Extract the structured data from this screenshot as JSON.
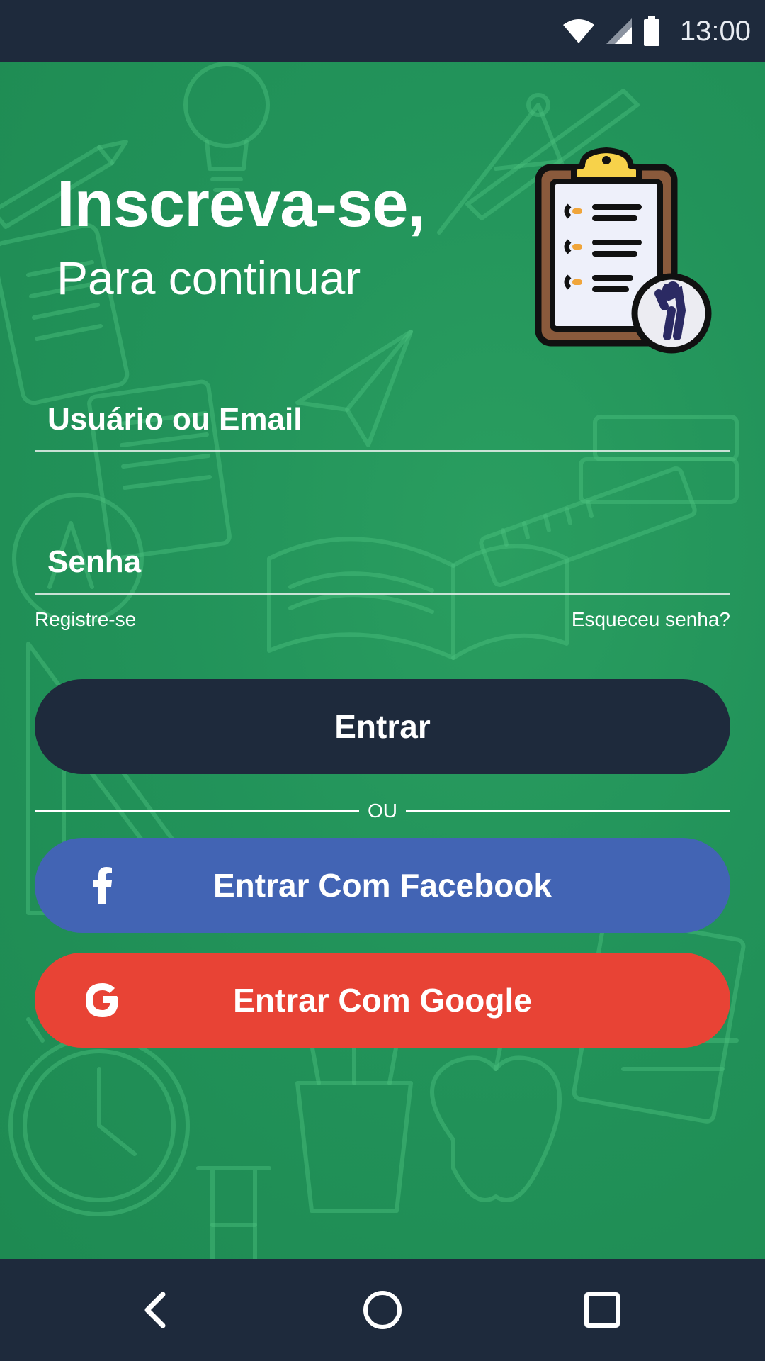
{
  "status_bar": {
    "time": "13:00",
    "icons": [
      "wifi-icon",
      "signal-icon",
      "battery-icon"
    ]
  },
  "header": {
    "title": "Inscreva-se,",
    "subtitle": "Para continuar",
    "illustration": "clipboard-icon"
  },
  "form": {
    "username_placeholder": "Usuário ou Email",
    "password_placeholder": "Senha",
    "register_link": "Registre-se",
    "forgot_link": "Esqueceu senha?",
    "login_button": "Entrar",
    "divider_text": "OU",
    "facebook_button": "Entrar Com Facebook",
    "google_button": "Entrar Com Google"
  },
  "colors": {
    "background_green": "#22935a",
    "dark_navy": "#1e2a3c",
    "facebook_blue": "#4264b4",
    "google_red": "#e84335"
  },
  "nav_bar": {
    "buttons": [
      "back-icon",
      "home-icon",
      "recents-icon"
    ]
  }
}
